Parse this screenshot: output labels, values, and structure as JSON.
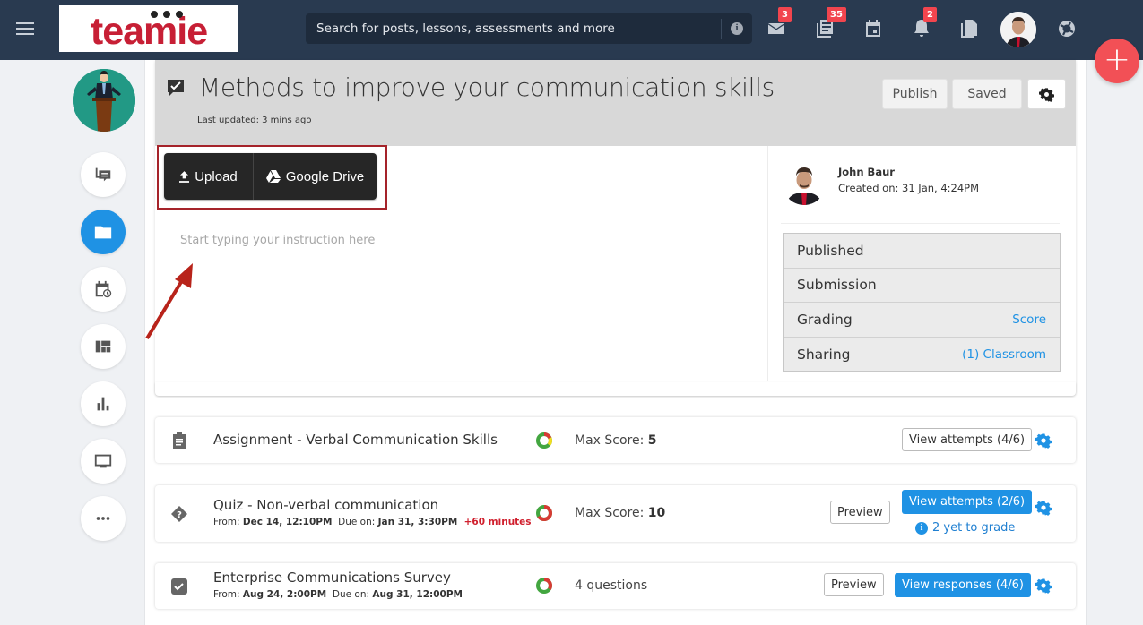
{
  "topbar": {
    "logo_text": "teamie",
    "search_placeholder": "Search for posts, lessons, assessments and more",
    "badges": {
      "messages": "3",
      "posts": "35",
      "notifications": "2"
    }
  },
  "fab_label": "+",
  "header": {
    "title": "Methods to improve your communication skills",
    "last_updated": "Last updated: 3 mins ago",
    "publish_label": "Publish",
    "saved_label": "Saved"
  },
  "editor": {
    "upload_label": "Upload",
    "gdrive_label": "Google Drive",
    "placeholder": "Start typing your instruction here"
  },
  "author": {
    "name": "John Baur",
    "created": "Created on: 31 Jan, 4:24PM"
  },
  "settings": [
    {
      "label": "Published",
      "value": ""
    },
    {
      "label": "Submission",
      "value": ""
    },
    {
      "label": "Grading",
      "value": "Score"
    },
    {
      "label": "Sharing",
      "value": "(1) Classroom"
    }
  ],
  "items": [
    {
      "title": "Assignment - Verbal Communication Skills",
      "stat_label": "Max Score: ",
      "stat_value": "5",
      "action_label": "View attempts (4/6)"
    },
    {
      "title": "Quiz - Non-verbal communication",
      "from_label": "From: ",
      "from_value": "Dec 14, 12:10PM",
      "due_label": "Due on: ",
      "due_value": "Jan 31, 3:30PM",
      "extra": "+60 minutes",
      "stat_label": "Max Score: ",
      "stat_value": "10",
      "preview_label": "Preview",
      "action_label": "View attempts (2/6)",
      "grade_note": "2 yet to grade"
    },
    {
      "title": "Enterprise Communications Survey",
      "from_label": "From: ",
      "from_value": "Aug 24, 2:00PM",
      "due_label": "Due on: ",
      "due_value": "Aug 31, 12:00PM",
      "stat_label": "4 questions",
      "preview_label": "Preview",
      "action_label": "View responses (4/6)"
    }
  ],
  "colors": {
    "topbar": "#293a50",
    "accent_blue": "#1f92e4",
    "fab_red": "#f25056",
    "badge_red": "#f2454e",
    "late_red": "#d0202e",
    "annotation_red": "#a5232a"
  }
}
